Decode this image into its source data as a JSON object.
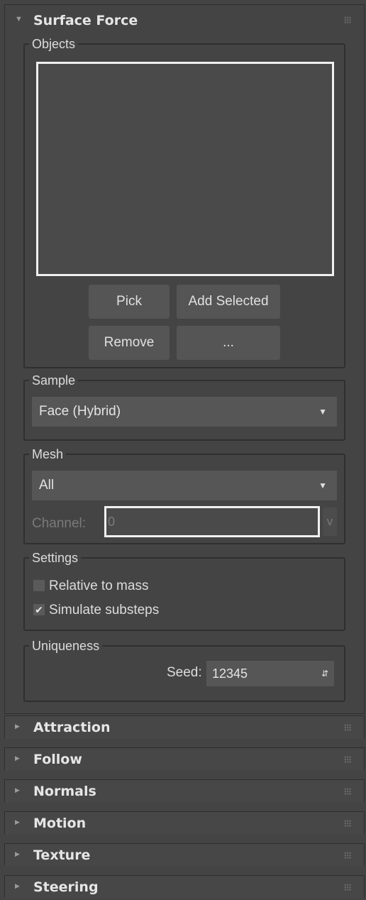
{
  "surface_force": {
    "title": "Surface Force",
    "expanded": true,
    "objects": {
      "label": "Objects",
      "pick_label": "Pick",
      "add_selected_label": "Add Selected",
      "remove_label": "Remove",
      "more_label": "..."
    },
    "sample": {
      "label": "Sample",
      "value": "Face (Hybrid)"
    },
    "mesh": {
      "label": "Mesh",
      "value": "All",
      "channel_label": "Channel:",
      "channel_value": "0",
      "channel_button": "v"
    },
    "settings": {
      "label": "Settings",
      "relative_to_mass": {
        "label": "Relative to mass",
        "checked": false
      },
      "simulate_substeps": {
        "label": "Simulate substeps",
        "checked": true
      }
    },
    "uniqueness": {
      "label": "Uniqueness",
      "seed_label": "Seed:",
      "seed_value": "12345"
    }
  },
  "collapsed_rollouts": [
    {
      "title": "Attraction"
    },
    {
      "title": "Follow"
    },
    {
      "title": "Normals"
    },
    {
      "title": "Motion"
    },
    {
      "title": "Texture"
    },
    {
      "title": "Steering"
    }
  ],
  "icons": {
    "expanded": "triangle-down-icon",
    "collapsed": "triangle-right-icon",
    "grip": "grip-icon",
    "dropdown": "chevron-down-icon",
    "spinner": "spinner-arrows-icon",
    "check": "checkmark-icon"
  },
  "colors": {
    "panel_bg": "#444444",
    "field_bg": "#565656",
    "listbox_border": "#f0f0f0"
  }
}
